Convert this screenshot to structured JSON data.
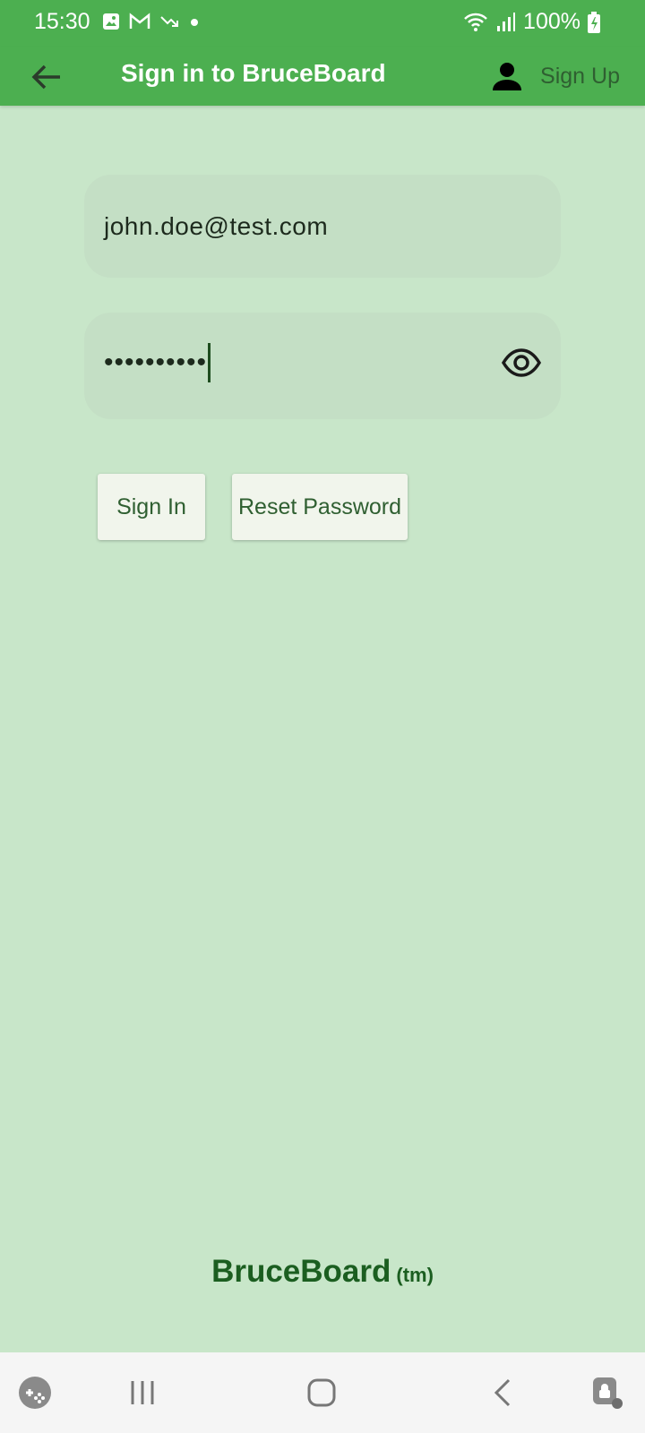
{
  "status_bar": {
    "time": "15:30",
    "battery": "100%",
    "left_icons": [
      "image-icon",
      "gmail-icon",
      "trend-down-icon",
      "dot-icon"
    ],
    "right_icons": [
      "wifi-icon",
      "signal-icon",
      "battery-charging-icon"
    ]
  },
  "app_bar": {
    "title": "Sign in to BruceBoard",
    "sign_up_label": "Sign Up",
    "color": "#4caf50"
  },
  "form": {
    "email_value": "john.doe@test.com",
    "password_value": "••••••••••"
  },
  "buttons": {
    "sign_in": "Sign In",
    "reset_password": "Reset Password"
  },
  "footer": {
    "brand": "BruceBoard",
    "tm": "(tm)"
  },
  "nav_bar": {
    "items": [
      "game-launcher-icon",
      "recent-apps-icon",
      "home-icon",
      "back-icon",
      "accessibility-icon"
    ]
  },
  "colors": {
    "background": "#c8e6c9",
    "primary": "#4caf50",
    "brand_text": "#1b5e20"
  }
}
